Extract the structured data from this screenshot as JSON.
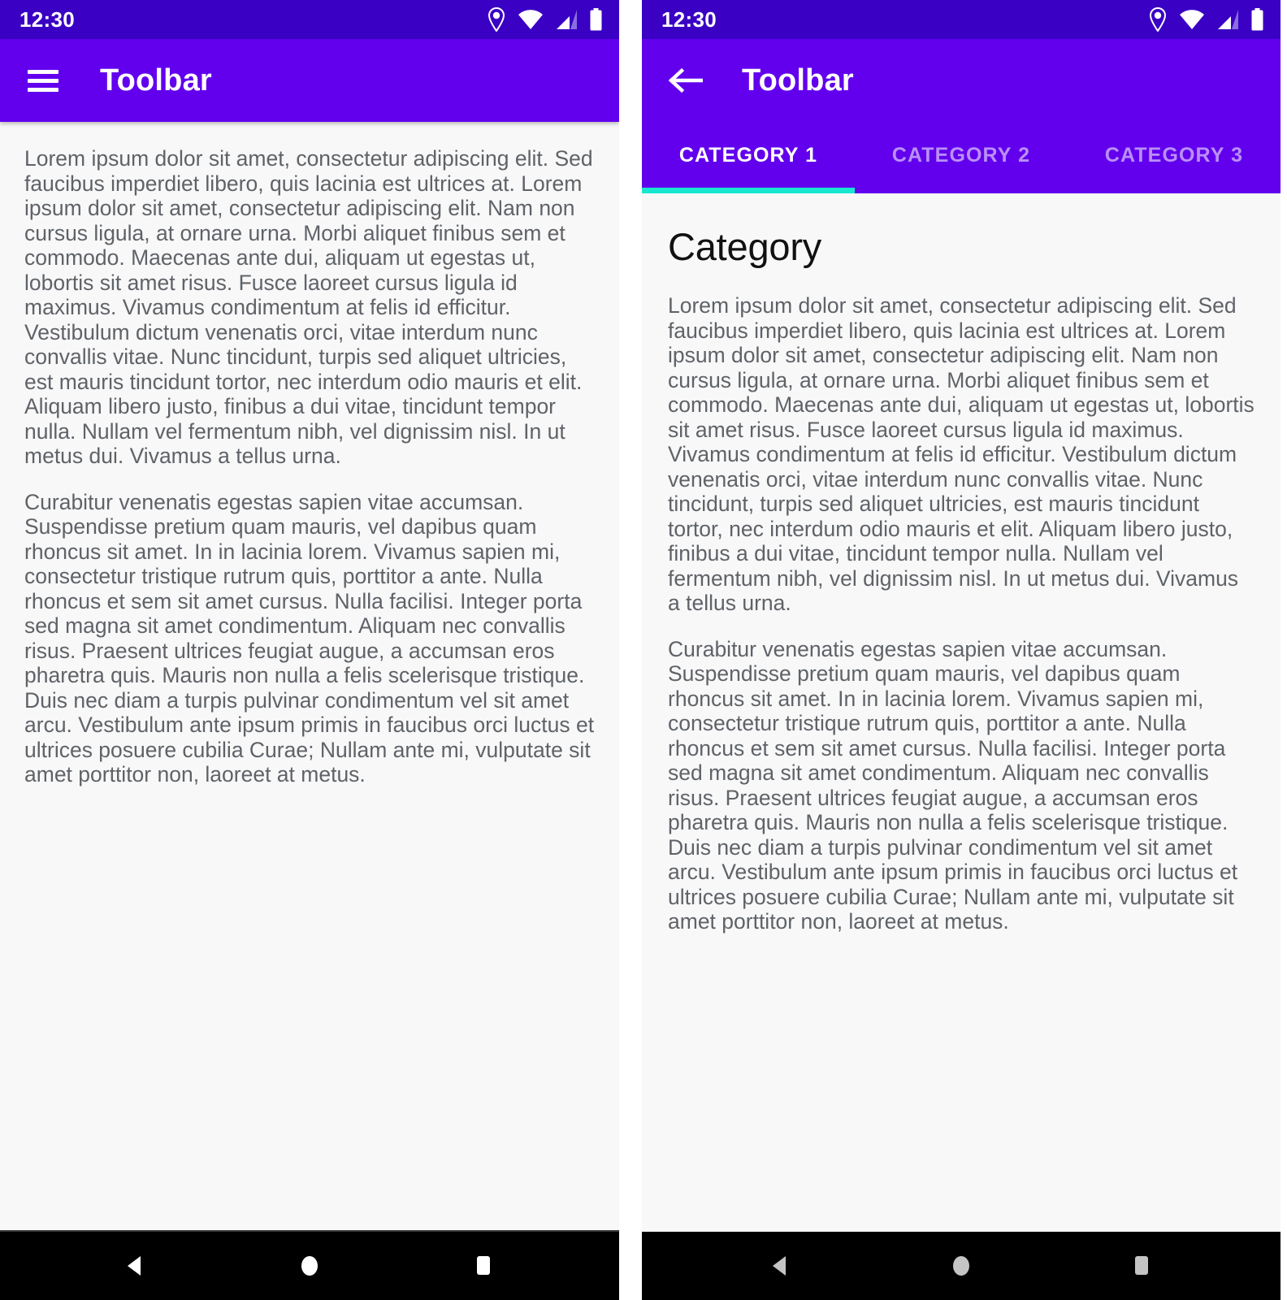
{
  "panels": [
    {
      "id": "left",
      "statusbar": {
        "time": "12:30",
        "icons": [
          "location-pin-icon",
          "wifi-icon",
          "cell-signal-icon",
          "battery-icon"
        ]
      },
      "toolbar": {
        "nav_icon": "hamburger-menu-icon",
        "title": "Toolbar"
      },
      "has_tabs": false,
      "content": {
        "heading": "",
        "paragraphs": [
          "Lorem ipsum dolor sit amet, consectetur adipiscing elit. Sed faucibus imperdiet libero, quis lacinia est ultrices at. Lorem ipsum dolor sit amet, consectetur adipiscing elit. Nam non cursus ligula, at ornare urna. Morbi aliquet finibus sem et commodo. Maecenas ante dui, aliquam ut egestas ut, lobortis sit amet risus. Fusce laoreet cursus ligula id maximus. Vivamus condimentum at felis id efficitur. Vestibulum dictum venenatis orci, vitae interdum nunc convallis vitae. Nunc tincidunt, turpis sed aliquet ultricies, est mauris tincidunt tortor, nec interdum odio mauris et elit. Aliquam libero justo, finibus a dui vitae, tincidunt tempor nulla. Nullam vel fermentum nibh, vel dignissim nisl. In ut metus dui. Vivamus a tellus urna.",
          "Curabitur venenatis egestas sapien vitae accumsan. Suspendisse pretium quam mauris, vel dapibus quam rhoncus sit amet. In in lacinia lorem. Vivamus sapien mi, consectetur tristique rutrum quis, porttitor a ante. Nulla rhoncus et sem sit amet cursus. Nulla facilisi. Integer porta sed magna sit amet condimentum. Aliquam nec convallis risus. Praesent ultrices feugiat augue, a accumsan eros pharetra quis. Mauris non nulla a felis scelerisque tristique. Duis nec diam a turpis pulvinar condimentum vel sit amet arcu. Vestibulum ante ipsum primis in faucibus orci luctus et ultrices posuere cubilia Curae; Nullam ante mi, vulputate sit amet porttitor non, laoreet at metus."
        ]
      },
      "navbar": {
        "back_label": "back-button",
        "home_label": "home-button",
        "recents_label": "recents-button",
        "icon_color": "#ffffff"
      }
    },
    {
      "id": "right",
      "statusbar": {
        "time": "12:30",
        "icons": [
          "location-pin-icon",
          "wifi-icon",
          "cell-signal-icon",
          "battery-icon"
        ]
      },
      "toolbar": {
        "nav_icon": "back-arrow-icon",
        "title": "Toolbar"
      },
      "has_tabs": true,
      "tabs": [
        {
          "label": "CATEGORY 1",
          "active": true
        },
        {
          "label": "CATEGORY 2",
          "active": false
        },
        {
          "label": "CATEGORY 3",
          "active": false
        }
      ],
      "content": {
        "heading": "Category",
        "paragraphs": [
          "Lorem ipsum dolor sit amet, consectetur adipiscing elit. Sed faucibus imperdiet libero, quis lacinia est ultrices at. Lorem ipsum dolor sit amet, consectetur adipiscing elit. Nam non cursus ligula, at ornare urna. Morbi aliquet finibus sem et commodo. Maecenas ante dui, aliquam ut egestas ut, lobortis sit amet risus. Fusce laoreet cursus ligula id maximus. Vivamus condimentum at felis id efficitur. Vestibulum dictum venenatis orci, vitae interdum nunc convallis vitae. Nunc tincidunt, turpis sed aliquet ultricies, est mauris tincidunt tortor, nec interdum odio mauris et elit. Aliquam libero justo, finibus a dui vitae, tincidunt tempor nulla. Nullam vel fermentum nibh, vel dignissim nisl. In ut metus dui. Vivamus a tellus urna.",
          "Curabitur venenatis egestas sapien vitae accumsan. Suspendisse pretium quam mauris, vel dapibus quam rhoncus sit amet. In in lacinia lorem. Vivamus sapien mi, consectetur tristique rutrum quis, porttitor a ante. Nulla rhoncus et sem sit amet cursus. Nulla facilisi. Integer porta sed magna sit amet condimentum. Aliquam nec convallis risus. Praesent ultrices feugiat augue, a accumsan eros pharetra quis. Mauris non nulla a felis scelerisque tristique. Duis nec diam a turpis pulvinar condimentum vel sit amet arcu. Vestibulum ante ipsum primis in faucibus orci luctus et ultrices posuere cubilia Curae; Nullam ante mi, vulputate sit amet porttitor non, laoreet at metus."
        ]
      },
      "navbar": {
        "back_label": "back-button",
        "home_label": "home-button",
        "recents_label": "recents-button",
        "icon_color": "#c4c4c4"
      }
    }
  ],
  "colors": {
    "status_bar": "#3a00c4",
    "toolbar": "#6200ee",
    "tab_indicator": "#18e7d0",
    "content_bg": "#f8f8f8",
    "body_text": "#5f6368",
    "heading_text": "#111111",
    "navbar_bg": "#000000"
  }
}
